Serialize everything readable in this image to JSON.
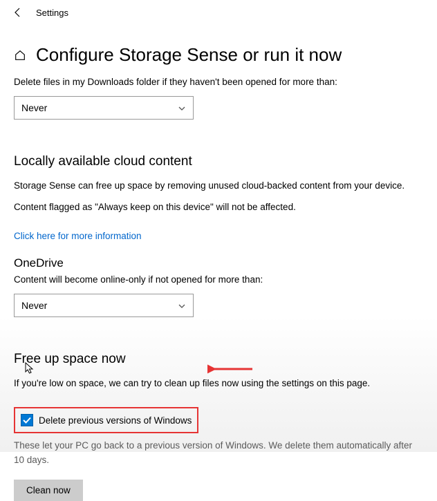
{
  "header": {
    "title": "Settings"
  },
  "page": {
    "title": "Configure Storage Sense or run it now"
  },
  "downloads": {
    "description": "Delete files in my Downloads folder if they haven't been opened for more than:",
    "selected": "Never"
  },
  "cloud": {
    "heading": "Locally available cloud content",
    "desc1": "Storage Sense can free up space by removing unused cloud-backed content from your device.",
    "desc2": "Content flagged as \"Always keep on this device\" will not be affected.",
    "link": "Click here for more information"
  },
  "onedrive": {
    "heading": "OneDrive",
    "description": "Content will become online-only if not opened for more than:",
    "selected": "Never"
  },
  "freeup": {
    "heading": "Free up space now",
    "description": "If you're low on space, we can try to clean up files now using the settings on this page.",
    "checkbox_label": "Delete previous versions of Windows",
    "note": "These let your PC go back to a previous version of Windows. We delete them automatically after 10 days.",
    "button": "Clean now"
  }
}
